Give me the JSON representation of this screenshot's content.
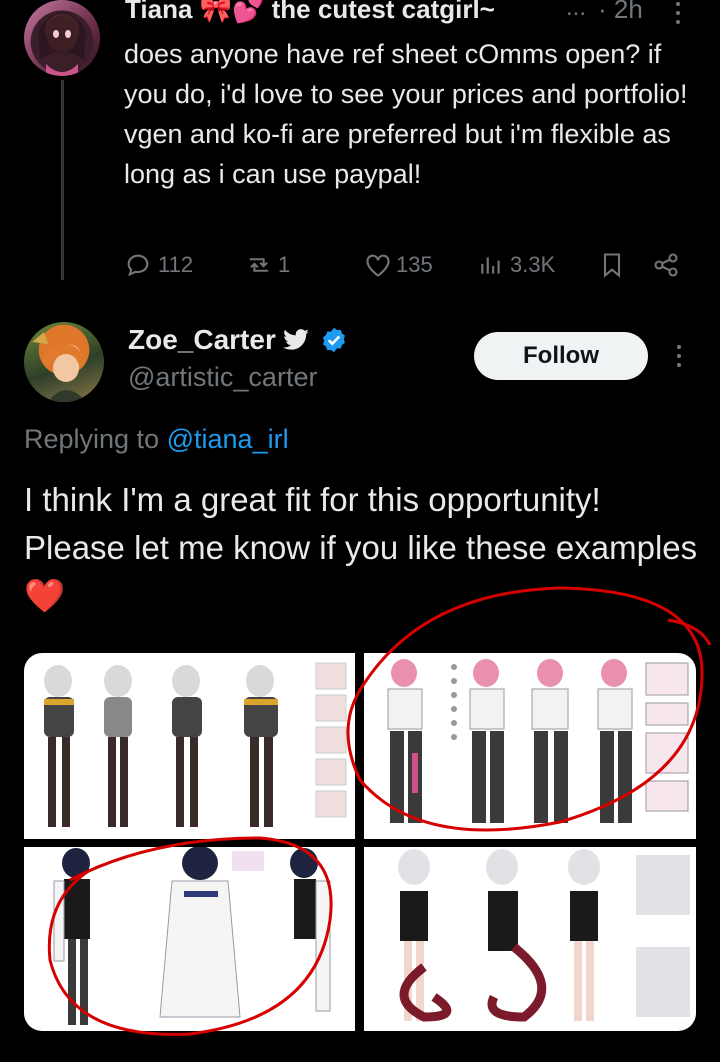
{
  "thread_post": {
    "display_name": "Tiana 🎀💕 the cutest catgirl~",
    "ellipsis": "...",
    "time": "· 2h",
    "text": "does anyone have ref sheet cOmms open? if you do, i'd love to see your prices and portfolio! vgen and ko-fi are preferred but i'm flexible as long as i can use paypal!",
    "stats": {
      "replies": "112",
      "reposts": "1",
      "likes": "135",
      "views": "3.3K"
    }
  },
  "reply_post": {
    "display_name": "Zoe_Carter",
    "handle": "@artistic_carter",
    "follow_label": "Follow",
    "replying_prefix": "Replying to",
    "replying_handle": "@tiana_irl",
    "text": "I think I'm a great fit for this opportunity! Please let me know if you like these examples ❤️"
  },
  "media": [
    {
      "name": "character-ref-sheet-1"
    },
    {
      "name": "character-ref-sheet-2"
    },
    {
      "name": "character-ref-sheet-3"
    },
    {
      "name": "character-ref-sheet-4"
    }
  ],
  "colors": {
    "accent": "#1d9bf0",
    "annotation": "#d60000",
    "muted": "#71767b"
  },
  "icons": [
    "reply-icon",
    "repost-icon",
    "like-icon",
    "views-icon",
    "bookmark-icon",
    "share-icon",
    "bird-icon",
    "verified-icon",
    "more-icon"
  ]
}
